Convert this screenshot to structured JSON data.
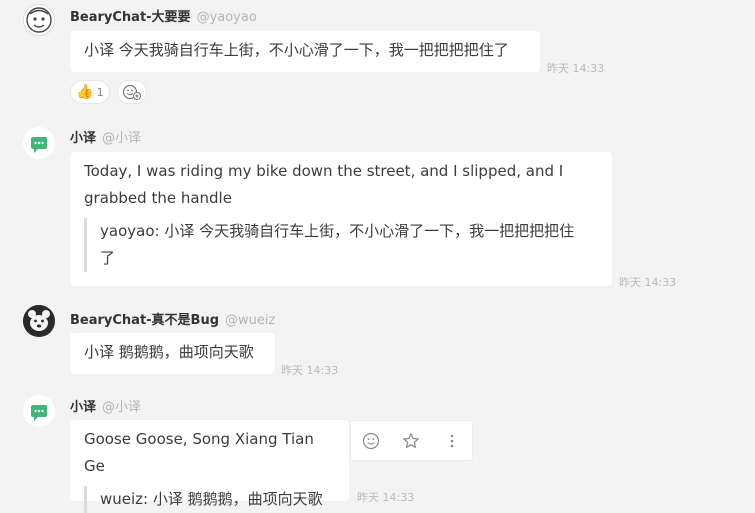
{
  "messages": [
    {
      "name": "BearyChat-大要要",
      "handle": "@yaoyao",
      "text": "小译 今天我骑自行车上街，不小心滑了一下，我一把把把把住了",
      "time": "昨天 14:33",
      "reactions": [
        {
          "icon": "thumbs-up-icon",
          "emoji": "👍",
          "count": "1"
        },
        {
          "icon": "add-reaction-icon"
        }
      ]
    },
    {
      "name": "小译",
      "handle": "@小译",
      "text_line1": "Today, I was riding my bike down the street, and I slipped, and I",
      "text_line2": "grabbed the handle",
      "quote_line1": "yaoyao: 小译 今天我骑自行车上街，不小心滑了一下，我一把把把把住",
      "quote_line2": "了",
      "time": "昨天 14:33"
    },
    {
      "name": "BearyChat-真不是Bug",
      "handle": "@wueiz",
      "text": "小译 鹅鹅鹅，曲项向天歌",
      "time": "昨天 14:33"
    },
    {
      "name": "小译",
      "handle": "@小译",
      "text": "Goose Goose, Song Xiang Tian Ge",
      "quote": "wueiz: 小译 鹅鹅鹅，曲项向天歌",
      "time": "昨天 14:33",
      "actions": [
        "smiley-icon",
        "star-icon",
        "more-vertical-icon"
      ]
    }
  ],
  "colors": {
    "bot_green": "#3fb77c",
    "background": "#f3f3f3",
    "bubble": "#ffffff"
  }
}
